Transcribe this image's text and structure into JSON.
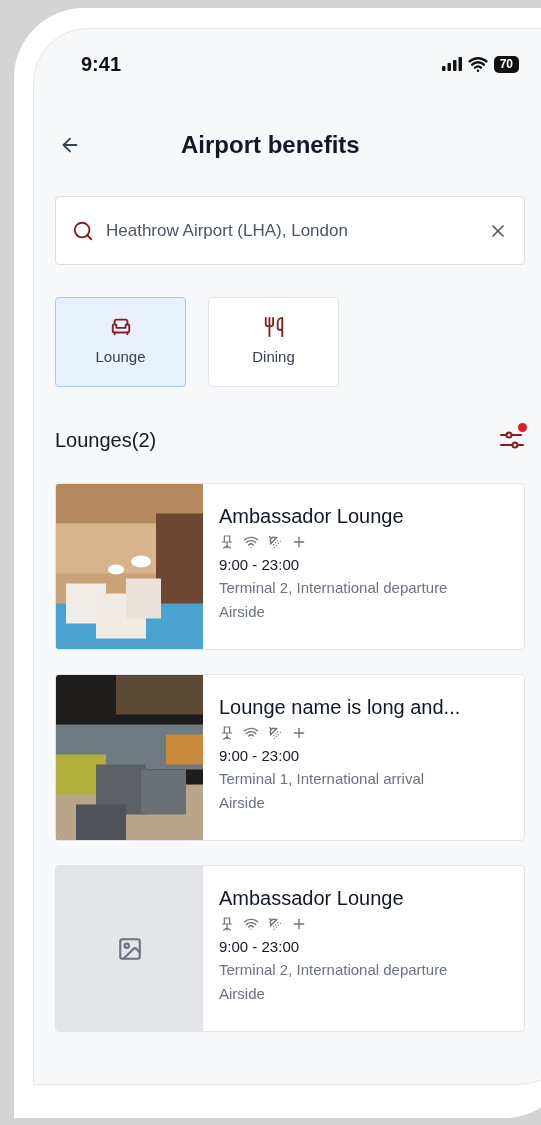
{
  "status_bar": {
    "time": "9:41",
    "battery": "70"
  },
  "header": {
    "title": "Airport benefits"
  },
  "search": {
    "value": "Heathrow Airport (LHA), London"
  },
  "categories": [
    {
      "label": "Lounge",
      "kind": "lounge",
      "selected": true
    },
    {
      "label": "Dining",
      "kind": "dining",
      "selected": false
    }
  ],
  "section": {
    "title": "Lounges(2)",
    "filter_active": true
  },
  "lounges": [
    {
      "kind": "picture",
      "name": "Ambassador Lounge",
      "hours": "9:00 - 23:00",
      "location": "Terminal 2, International departure",
      "area": "Airside"
    },
    {
      "kind": "picture",
      "name": "Lounge name is long and...",
      "hours": "9:00 - 23:00",
      "location": "Terminal 1, International arrival",
      "area": "Airside"
    },
    {
      "kind": "placeholder",
      "name": "Ambassador Lounge",
      "hours": "9:00 - 23:00",
      "location": "Terminal 2, International departure",
      "area": "Airside"
    }
  ]
}
